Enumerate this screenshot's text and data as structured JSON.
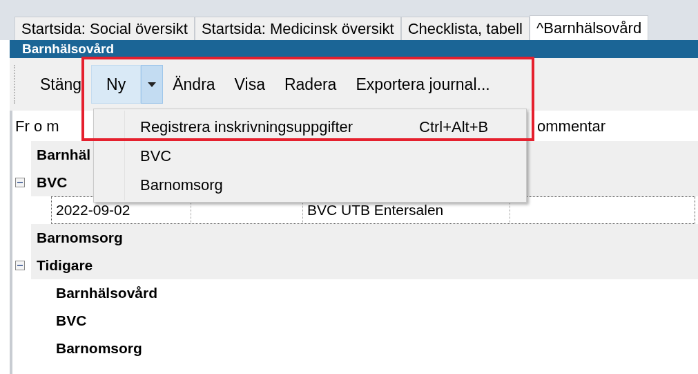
{
  "tabs": [
    {
      "label": "Startsida: Social översikt",
      "selected": false
    },
    {
      "label": "Startsida: Medicinsk översikt",
      "selected": false
    },
    {
      "label": "Checklista, tabell",
      "selected": false
    },
    {
      "label": "^Barnhälsovård",
      "selected": true
    }
  ],
  "panel_title": "Barnhälsovård",
  "toolbar": [
    {
      "kind": "button",
      "label": "Stäng"
    },
    {
      "kind": "split",
      "label": "Ny"
    },
    {
      "kind": "button",
      "label": "Ändra"
    },
    {
      "kind": "button",
      "label": "Visa"
    },
    {
      "kind": "button",
      "label": "Radera"
    },
    {
      "kind": "button",
      "label": "Exportera journal..."
    }
  ],
  "dropdown_menu": [
    {
      "label": "Registrera inskrivningsuppgifter",
      "shortcut": "Ctrl+Alt+B"
    },
    {
      "label": "BVC"
    },
    {
      "label": "Barnomsorg"
    }
  ],
  "columns": [
    "Fr o m",
    "ommentar"
  ],
  "tree": [
    {
      "label": "Barnhäl"
    },
    {
      "label": "BVC",
      "expanded": true,
      "children": [
        {
          "kind": "entry",
          "cells": [
            "2022-09-02",
            "",
            "BVC UTB Entersalen",
            ""
          ]
        }
      ]
    },
    {
      "label": "Barnomsorg"
    },
    {
      "label": "Tidigare",
      "expanded": true,
      "children": [
        {
          "kind": "group",
          "label": "Barnhälsovård"
        },
        {
          "kind": "group",
          "label": "BVC"
        },
        {
          "kind": "group",
          "label": "Barnomsorg"
        }
      ]
    }
  ]
}
